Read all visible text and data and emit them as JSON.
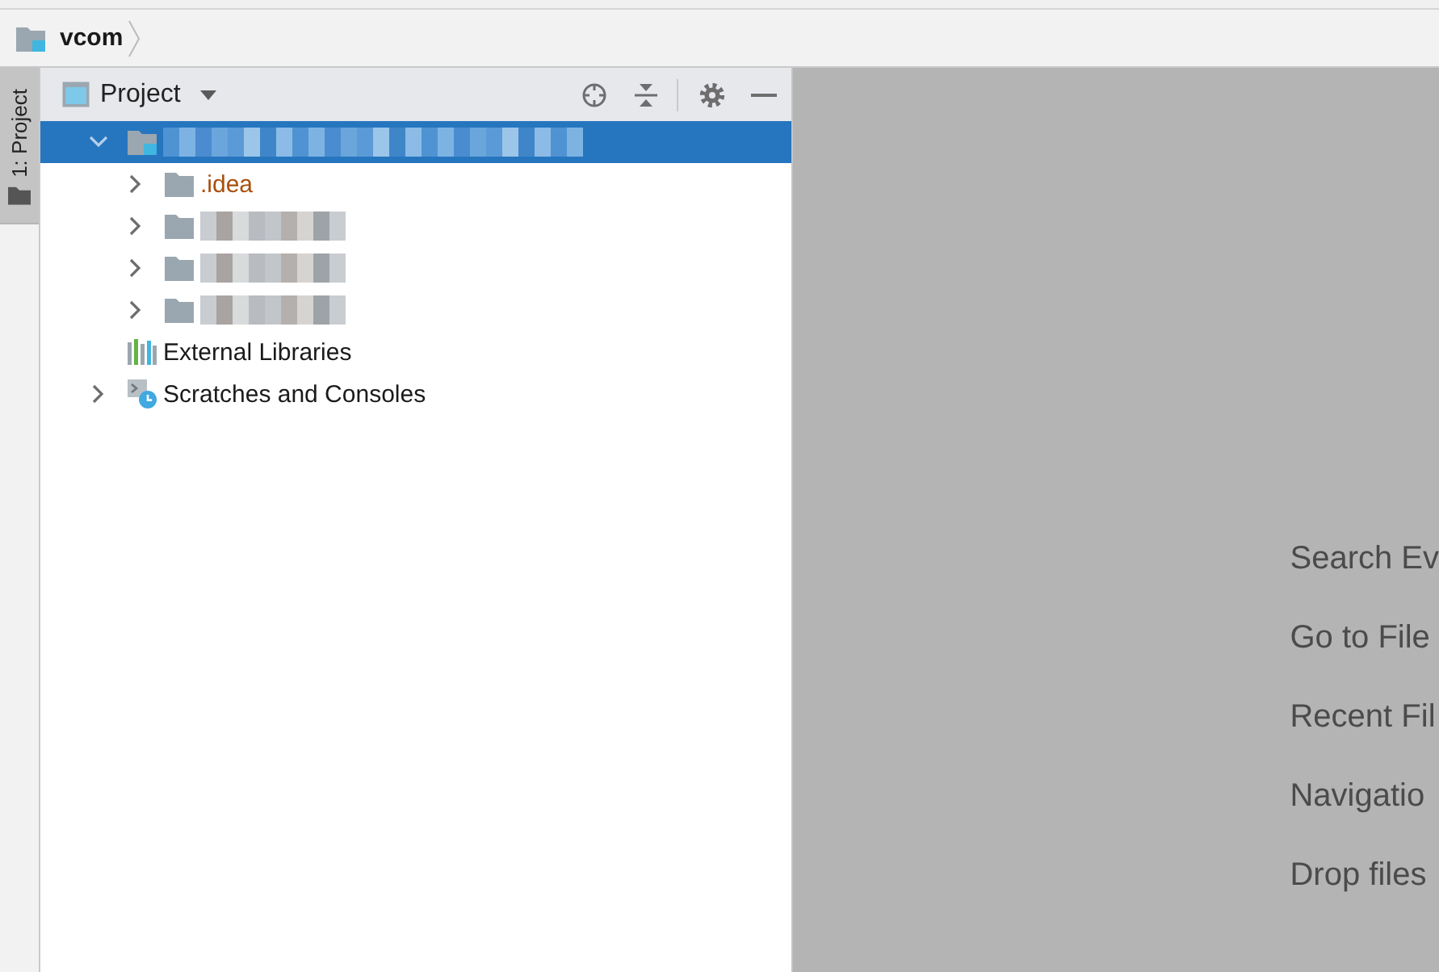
{
  "navbar": {
    "crumbs": [
      {
        "label": "vcom",
        "kind": "module"
      }
    ]
  },
  "tool_strip": {
    "tabs": [
      {
        "label": "1: Project",
        "selected": true
      }
    ]
  },
  "project_panel": {
    "title": "Project",
    "tree": [
      {
        "kind": "module",
        "blurred": true,
        "expanded": true,
        "selected": true,
        "children": [
          {
            "kind": "folder",
            "label": ".idea",
            "excluded": true,
            "expanded": false,
            "selected": false
          },
          {
            "kind": "folder",
            "blurred": true,
            "expanded": false,
            "selected": false
          },
          {
            "kind": "folder",
            "blurred": true,
            "expanded": false,
            "selected": false
          },
          {
            "kind": "folder",
            "blurred": true,
            "expanded": false,
            "selected": false
          }
        ]
      },
      {
        "kind": "libraries",
        "label": "External Libraries",
        "selected": false
      },
      {
        "kind": "scratches",
        "label": "Scratches and Consoles",
        "expanded": false,
        "selected": false
      }
    ]
  },
  "editor": {
    "hints": [
      "Search Ev",
      "Go to File",
      "Recent Fil",
      "Navigatio",
      "Drop files"
    ]
  }
}
